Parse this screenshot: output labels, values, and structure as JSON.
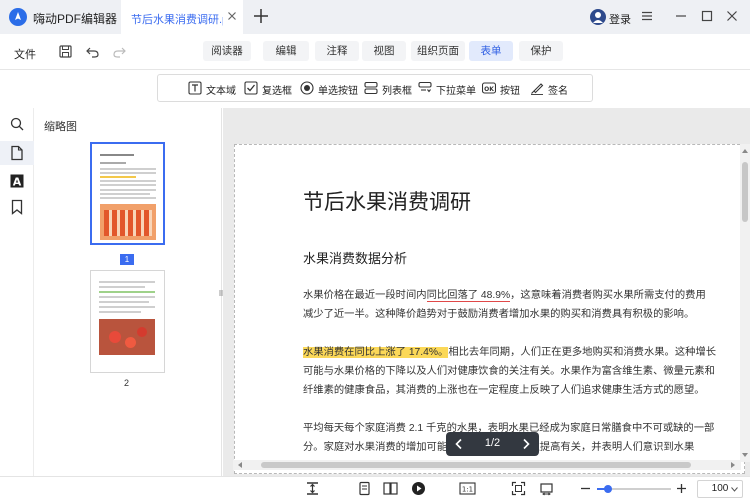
{
  "titlebar": {
    "app_name": "嗨动PDF编辑器",
    "doc_tab_title": "节后水果消费调研.p...",
    "login_label": "登录"
  },
  "menubar": {
    "file_label": "文件",
    "tabs": [
      "阅读器",
      "编辑",
      "注释",
      "视图",
      "组织页面",
      "表单",
      "保护"
    ],
    "active_tab": "表单"
  },
  "form_toolbar": {
    "tools": [
      {
        "label": "文本域",
        "icon": "text-field-icon"
      },
      {
        "label": "复选框",
        "icon": "checkbox-icon"
      },
      {
        "label": "单选按钮",
        "icon": "radio-button-icon"
      },
      {
        "label": "列表框",
        "icon": "list-box-icon"
      },
      {
        "label": "下拉菜单",
        "icon": "dropdown-icon"
      },
      {
        "label": "按钮",
        "icon": "ok-button-icon"
      },
      {
        "label": "签名",
        "icon": "signature-icon"
      }
    ]
  },
  "sidebar": {
    "heading": "缩略图",
    "thumbnails": [
      {
        "label": "1",
        "selected": true
      },
      {
        "label": "2",
        "selected": false
      }
    ]
  },
  "document": {
    "title": "节后水果消费调研",
    "section_title": "水果消费数据分析",
    "para1_line1_a": "水果价格在最近一段时间内",
    "para1_line1_ul": "同比回落了 48.9%",
    "para1_line1_b": "，这意味着消费者购买水果所需支付的费用",
    "para1_line2": "减少了近一半。这种降价趋势对于鼓励消费者增加水果的购买和消费具有积极的影响。",
    "para2_line1_hl": "水果消费在同比上涨了 17.4%。",
    "para2_line1_b": "相比去年同期，人们正在更多地购买和消费水果。这种增长",
    "para2_line2": "可能与水果价格的下降以及人们对健康饮食的关注有关。水果作为富含维生素、微量元素和",
    "para2_line3": "纤维素的健康食品，其消费的上涨也在一定程度上反映了人们追求健康生活方式的愿望。",
    "para3_line1": "平均每天每个家庭消费 2.1 千克的水果，表明水果已经成为家庭日常膳食中不可或缺的一部",
    "para3_line2": "分。家庭对水果消费的增加可能与人们对健康的关注提高有关，并表明人们意识到水果"
  },
  "page_nav": {
    "indicator": "1/2"
  },
  "statusbar": {
    "zoom_value": "100",
    "zoom_level": 0.15
  }
}
